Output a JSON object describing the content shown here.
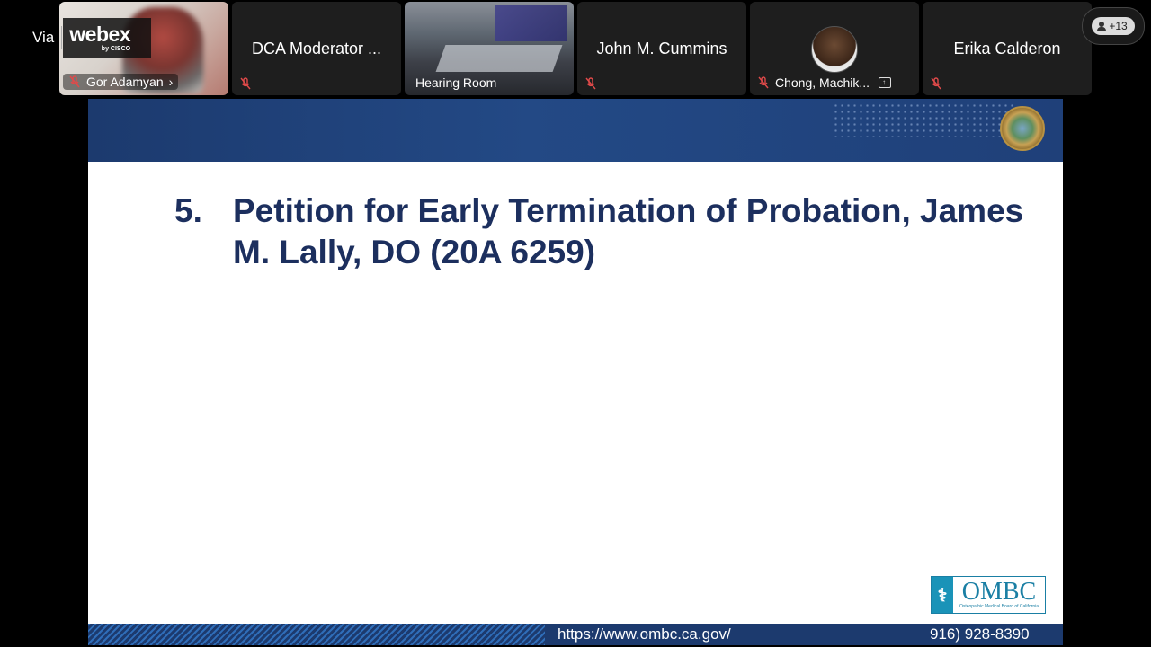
{
  "branding": {
    "via": "Via",
    "brand": "webex",
    "sub": "by CISCO"
  },
  "participants": [
    {
      "name": "Gor Adamyan",
      "chevron": "›",
      "muted": true
    },
    {
      "name": "DCA Moderator ...",
      "muted": true
    },
    {
      "name": "Hearing Room"
    },
    {
      "name": "John M. Cummins",
      "muted": true
    },
    {
      "name": "Chong, Machik...",
      "muted": true
    },
    {
      "name": "Erika Calderon",
      "muted": true
    }
  ],
  "participant_count": "+13",
  "slide": {
    "number": "5.",
    "title": "Petition for Early Termination of Probation, James M. Lally, DO (20A 6259)",
    "logo_text": "OMBC",
    "logo_sub": "Osteopathic Medical Board of California",
    "url": "https://www.ombc.ca.gov/",
    "phone": "916) 928-8390"
  },
  "colors": {
    "header": "#1c3a6e",
    "title": "#1c2f5e",
    "muted_mic": "#e04a4a"
  }
}
